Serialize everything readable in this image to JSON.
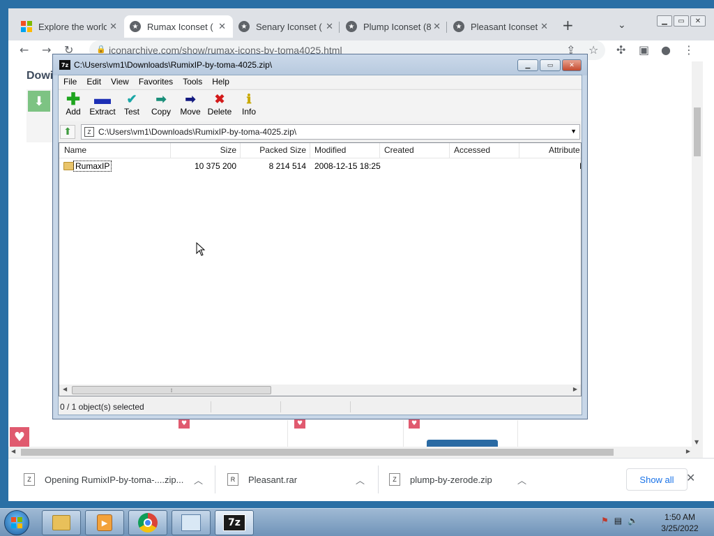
{
  "browser": {
    "tabs": [
      {
        "label": "Explore the world",
        "icon": "microsoft-icon",
        "active": false
      },
      {
        "label": "Rumax Iconset (",
        "icon": "star-icon",
        "active": true
      },
      {
        "label": "Senary Iconset (",
        "icon": "star-icon",
        "active": false
      },
      {
        "label": "Plump Iconset (8",
        "icon": "star-icon",
        "active": false
      },
      {
        "label": "Pleasant Iconset",
        "icon": "star-icon",
        "active": false
      }
    ],
    "url": "iconarchive.com/show/rumax-icons-by-toma4025.html",
    "page_heading": "Dowi",
    "downloads": [
      {
        "label": "Opening RumixIP-by-toma-....zip...",
        "icon": "zip-file-icon"
      },
      {
        "label": "Pleasant.rar",
        "icon": "rar-file-icon"
      },
      {
        "label": "plump-by-zerode.zip",
        "icon": "zip-file-icon"
      }
    ],
    "show_all_label": "Show all"
  },
  "sevenzip": {
    "title": "C:\\Users\\vm1\\Downloads\\RumixIP-by-toma-4025.zip\\",
    "menu": [
      "File",
      "Edit",
      "View",
      "Favorites",
      "Tools",
      "Help"
    ],
    "toolbar": [
      {
        "label": "Add",
        "icon": "plus-icon",
        "color": "#1fa51f"
      },
      {
        "label": "Extract",
        "icon": "minus-icon",
        "color": "#1c2fb5"
      },
      {
        "label": "Test",
        "icon": "check-icon",
        "color": "#1aa6a6"
      },
      {
        "label": "Copy",
        "icon": "copy-arrow-icon",
        "color": "#1a8f7a"
      },
      {
        "label": "Move",
        "icon": "move-arrow-icon",
        "color": "#131a80"
      },
      {
        "label": "Delete",
        "icon": "delete-x-icon",
        "color": "#d31a1a"
      },
      {
        "label": "Info",
        "icon": "info-icon",
        "color": "#c8a800"
      }
    ],
    "path": "C:\\Users\\vm1\\Downloads\\RumixIP-by-toma-4025.zip\\",
    "columns": [
      "Name",
      "Size",
      "Packed Size",
      "Modified",
      "Created",
      "Accessed",
      "Attribute"
    ],
    "rows": [
      {
        "name": "RumaxIP",
        "size": "10 375 200",
        "packed": "8 214 514",
        "modified": "2008-12-15 18:25",
        "created": "",
        "accessed": "",
        "attr": "I"
      }
    ],
    "status": "0 / 1 object(s) selected"
  },
  "taskbar": {
    "time": "1:50 AM",
    "date": "3/25/2022",
    "apps": [
      "explorer-icon",
      "media-player-icon",
      "chrome-icon",
      "control-panel-icon",
      "7zip-icon"
    ]
  },
  "colors": {
    "tab_bar": "#dee1e6",
    "accent_link": "#1a73e8",
    "window_frame": "#c8d7e8",
    "taskbar": "#7f9fc2"
  }
}
